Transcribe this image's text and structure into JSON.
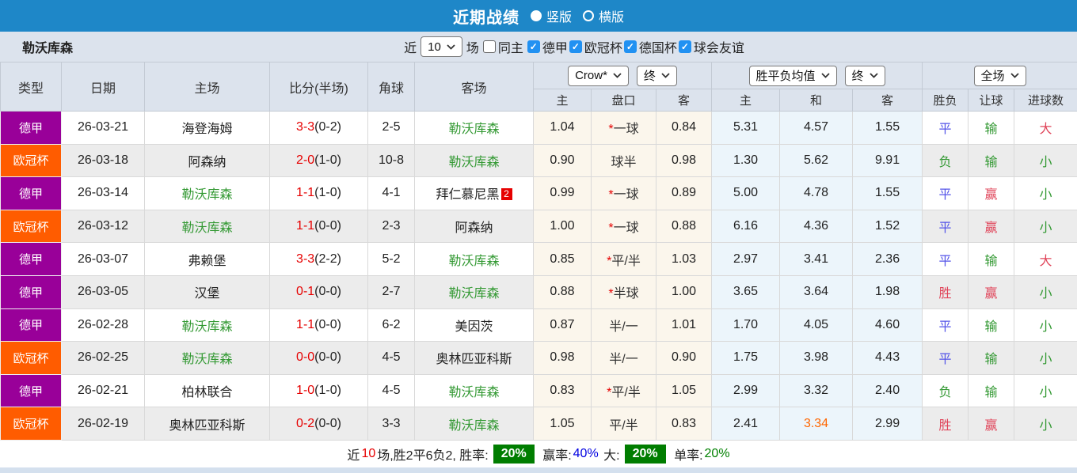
{
  "colors": {
    "topbar_blue": "#1e87c8",
    "panel_bg": "#dce3ed",
    "checkbox_blue": "#2191f2",
    "league_purple": "#990099",
    "league_orange": "#ff5c00",
    "team_green": "#339933",
    "score_red": "#e60000",
    "result_blue": "#5353e8",
    "result_green": "#339933",
    "result_red": "#e0455a",
    "highlight_orange": "#ff6600",
    "summary_green_bg": "#007d00",
    "summary_blue": "#0000e0",
    "summary_green": "#008000",
    "cream_bg": "#fbf6ec",
    "lightblue_bg": "#ecf5fb",
    "row_alt": "#ececec"
  },
  "header": {
    "title": "近期战绩",
    "vertical_label": "竖版",
    "horizontal_label": "横版",
    "vertical_selected": true
  },
  "filter": {
    "team": "勒沃库森",
    "near_label": "近",
    "count_value": "10",
    "matches_label": "场",
    "same_home_label": "同主",
    "same_home_checked": false,
    "leagues": [
      {
        "label": "德甲",
        "checked": true
      },
      {
        "label": "欧冠杯",
        "checked": true
      },
      {
        "label": "德国杯",
        "checked": true
      },
      {
        "label": "球会友谊",
        "checked": true
      }
    ]
  },
  "table": {
    "left_headers": [
      "类型",
      "日期",
      "主场",
      "比分(半场)",
      "角球",
      "客场"
    ],
    "sub_headers": [
      "主",
      "盘口",
      "客",
      "主",
      "和",
      "客",
      "胜负",
      "让球",
      "进球数"
    ],
    "dropdowns": {
      "company": "Crow*",
      "final1": "终",
      "avg": "胜平负均值",
      "final2": "终",
      "scope": "全场"
    },
    "result_colors": {
      "blue": "#5353e8",
      "green": "#339933",
      "red": "#e0455a"
    },
    "rows": [
      {
        "league": "德甲",
        "league_color": "purple",
        "date": "26-03-21",
        "home": "海登海姆",
        "home_is_target": false,
        "score": "3-3",
        "half": "(0-2)",
        "corner": "2-5",
        "away": "勒沃库森",
        "away_is_target": true,
        "away_badge": "",
        "crow_home": "1.04",
        "handicap_star": true,
        "handicap": "一球",
        "crow_away": "0.84",
        "avg_home": "5.31",
        "avg_draw": "4.57",
        "avg_draw_orange": false,
        "avg_away": "1.55",
        "result_wdl": "平",
        "result_wdl_color": "blue",
        "result_handicap": "输",
        "result_handicap_color": "green",
        "result_goals": "大",
        "result_goals_color": "red"
      },
      {
        "league": "欧冠杯",
        "league_color": "orange",
        "date": "26-03-18",
        "home": "阿森纳",
        "home_is_target": false,
        "score": "2-0",
        "half": "(1-0)",
        "corner": "10-8",
        "away": "勒沃库森",
        "away_is_target": true,
        "away_badge": "",
        "crow_home": "0.90",
        "handicap_star": false,
        "handicap": "球半",
        "crow_away": "0.98",
        "avg_home": "1.30",
        "avg_draw": "5.62",
        "avg_draw_orange": false,
        "avg_away": "9.91",
        "result_wdl": "负",
        "result_wdl_color": "green",
        "result_handicap": "输",
        "result_handicap_color": "green",
        "result_goals": "小",
        "result_goals_color": "green"
      },
      {
        "league": "德甲",
        "league_color": "purple",
        "date": "26-03-14",
        "home": "勒沃库森",
        "home_is_target": true,
        "score": "1-1",
        "half": "(1-0)",
        "corner": "4-1",
        "away": "拜仁慕尼黑",
        "away_is_target": false,
        "away_badge": "2",
        "crow_home": "0.99",
        "handicap_star": true,
        "handicap": "一球",
        "crow_away": "0.89",
        "avg_home": "5.00",
        "avg_draw": "4.78",
        "avg_draw_orange": false,
        "avg_away": "1.55",
        "result_wdl": "平",
        "result_wdl_color": "blue",
        "result_handicap": "赢",
        "result_handicap_color": "red",
        "result_goals": "小",
        "result_goals_color": "green"
      },
      {
        "league": "欧冠杯",
        "league_color": "orange",
        "date": "26-03-12",
        "home": "勒沃库森",
        "home_is_target": true,
        "score": "1-1",
        "half": "(0-0)",
        "corner": "2-3",
        "away": "阿森纳",
        "away_is_target": false,
        "away_badge": "",
        "crow_home": "1.00",
        "handicap_star": true,
        "handicap": "一球",
        "crow_away": "0.88",
        "avg_home": "6.16",
        "avg_draw": "4.36",
        "avg_draw_orange": false,
        "avg_away": "1.52",
        "result_wdl": "平",
        "result_wdl_color": "blue",
        "result_handicap": "赢",
        "result_handicap_color": "red",
        "result_goals": "小",
        "result_goals_color": "green"
      },
      {
        "league": "德甲",
        "league_color": "purple",
        "date": "26-03-07",
        "home": "弗赖堡",
        "home_is_target": false,
        "score": "3-3",
        "half": "(2-2)",
        "corner": "5-2",
        "away": "勒沃库森",
        "away_is_target": true,
        "away_badge": "",
        "crow_home": "0.85",
        "handicap_star": true,
        "handicap": "平/半",
        "crow_away": "1.03",
        "avg_home": "2.97",
        "avg_draw": "3.41",
        "avg_draw_orange": false,
        "avg_away": "2.36",
        "result_wdl": "平",
        "result_wdl_color": "blue",
        "result_handicap": "输",
        "result_handicap_color": "green",
        "result_goals": "大",
        "result_goals_color": "red"
      },
      {
        "league": "德甲",
        "league_color": "purple",
        "date": "26-03-05",
        "home": "汉堡",
        "home_is_target": false,
        "score": "0-1",
        "half": "(0-0)",
        "corner": "2-7",
        "away": "勒沃库森",
        "away_is_target": true,
        "away_badge": "",
        "crow_home": "0.88",
        "handicap_star": true,
        "handicap": "半球",
        "crow_away": "1.00",
        "avg_home": "3.65",
        "avg_draw": "3.64",
        "avg_draw_orange": false,
        "avg_away": "1.98",
        "result_wdl": "胜",
        "result_wdl_color": "red",
        "result_handicap": "赢",
        "result_handicap_color": "red",
        "result_goals": "小",
        "result_goals_color": "green"
      },
      {
        "league": "德甲",
        "league_color": "purple",
        "date": "26-02-28",
        "home": "勒沃库森",
        "home_is_target": true,
        "score": "1-1",
        "half": "(0-0)",
        "corner": "6-2",
        "away": "美因茨",
        "away_is_target": false,
        "away_badge": "",
        "crow_home": "0.87",
        "handicap_star": false,
        "handicap": "半/一",
        "crow_away": "1.01",
        "avg_home": "1.70",
        "avg_draw": "4.05",
        "avg_draw_orange": false,
        "avg_away": "4.60",
        "result_wdl": "平",
        "result_wdl_color": "blue",
        "result_handicap": "输",
        "result_handicap_color": "green",
        "result_goals": "小",
        "result_goals_color": "green"
      },
      {
        "league": "欧冠杯",
        "league_color": "orange",
        "date": "26-02-25",
        "home": "勒沃库森",
        "home_is_target": true,
        "score": "0-0",
        "half": "(0-0)",
        "corner": "4-5",
        "away": "奥林匹亚科斯",
        "away_is_target": false,
        "away_badge": "",
        "crow_home": "0.98",
        "handicap_star": false,
        "handicap": "半/一",
        "crow_away": "0.90",
        "avg_home": "1.75",
        "avg_draw": "3.98",
        "avg_draw_orange": false,
        "avg_away": "4.43",
        "result_wdl": "平",
        "result_wdl_color": "blue",
        "result_handicap": "输",
        "result_handicap_color": "green",
        "result_goals": "小",
        "result_goals_color": "green"
      },
      {
        "league": "德甲",
        "league_color": "purple",
        "date": "26-02-21",
        "home": "柏林联合",
        "home_is_target": false,
        "score": "1-0",
        "half": "(1-0)",
        "corner": "4-5",
        "away": "勒沃库森",
        "away_is_target": true,
        "away_badge": "",
        "crow_home": "0.83",
        "handicap_star": true,
        "handicap": "平/半",
        "crow_away": "1.05",
        "avg_home": "2.99",
        "avg_draw": "3.32",
        "avg_draw_orange": false,
        "avg_away": "2.40",
        "result_wdl": "负",
        "result_wdl_color": "green",
        "result_handicap": "输",
        "result_handicap_color": "green",
        "result_goals": "小",
        "result_goals_color": "green"
      },
      {
        "league": "欧冠杯",
        "league_color": "orange",
        "date": "26-02-19",
        "home": "奥林匹亚科斯",
        "home_is_target": false,
        "score": "0-2",
        "half": "(0-0)",
        "corner": "3-3",
        "away": "勒沃库森",
        "away_is_target": true,
        "away_badge": "",
        "crow_home": "1.05",
        "handicap_star": false,
        "handicap": "平/半",
        "crow_away": "0.83",
        "avg_home": "2.41",
        "avg_draw": "3.34",
        "avg_draw_orange": true,
        "avg_away": "2.99",
        "result_wdl": "胜",
        "result_wdl_color": "red",
        "result_handicap": "赢",
        "result_handicap_color": "red",
        "result_goals": "小",
        "result_goals_color": "green"
      }
    ]
  },
  "summary": {
    "segments": [
      {
        "text": "近",
        "style": "plain"
      },
      {
        "text": "10",
        "style": "red"
      },
      {
        "text": "场,胜2平6负2, 胜率:",
        "style": "plain"
      },
      {
        "text": "20%",
        "style": "green_box"
      },
      {
        "text": " 赢率:",
        "style": "plain"
      },
      {
        "text": "40%",
        "style": "blue"
      },
      {
        "text": " 大:",
        "style": "plain"
      },
      {
        "text": "20%",
        "style": "green_box"
      },
      {
        "text": " 单率:",
        "style": "plain"
      },
      {
        "text": "20%",
        "style": "green"
      }
    ]
  }
}
